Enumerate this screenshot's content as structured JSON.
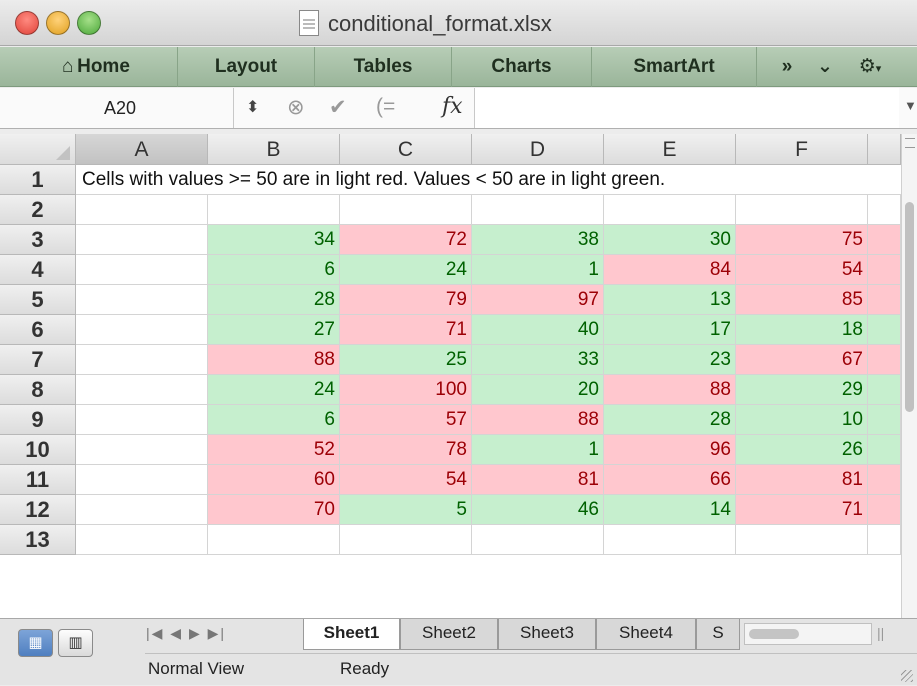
{
  "window": {
    "title": "conditional_format.xlsx"
  },
  "ribbon": {
    "tabs": [
      "Home",
      "Layout",
      "Tables",
      "Charts",
      "SmartArt"
    ],
    "overflow": "»",
    "chevron": "⌄",
    "gear": "⚙"
  },
  "formula_bar": {
    "cell_ref": "A20",
    "fx_label": "fx",
    "value": ""
  },
  "sheet": {
    "columns": [
      "A",
      "B",
      "C",
      "D",
      "E",
      "F"
    ],
    "rows": [
      "1",
      "2",
      "3",
      "4",
      "5",
      "6",
      "7",
      "8",
      "9",
      "10",
      "11",
      "12",
      "13"
    ],
    "row1_text": "Cells with values >= 50 are in light red. Values < 50 are in light green.",
    "data": [
      [
        34,
        72,
        38,
        30,
        75
      ],
      [
        6,
        24,
        1,
        84,
        54
      ],
      [
        28,
        79,
        97,
        13,
        85
      ],
      [
        27,
        71,
        40,
        17,
        18
      ],
      [
        88,
        25,
        33,
        23,
        67
      ],
      [
        24,
        100,
        20,
        88,
        29
      ],
      [
        6,
        57,
        88,
        28,
        10
      ],
      [
        52,
        78,
        1,
        96,
        26
      ],
      [
        60,
        54,
        81,
        66,
        81
      ],
      [
        70,
        5,
        46,
        14,
        71
      ]
    ],
    "threshold": 50,
    "colors": {
      "red_fill": "#ffc7ce",
      "red_text": "#9c0006",
      "green_fill": "#c6efce",
      "green_text": "#006100"
    }
  },
  "sheet_tabs": [
    "Sheet1",
    "Sheet2",
    "Sheet3",
    "Sheet4",
    "S"
  ],
  "status": {
    "view": "Normal View",
    "state": "Ready"
  }
}
